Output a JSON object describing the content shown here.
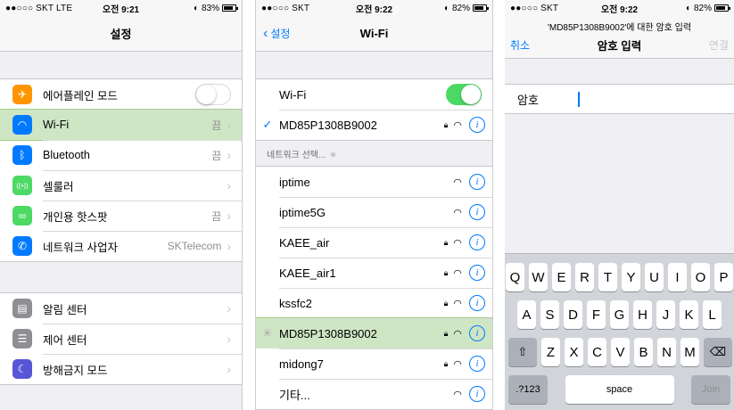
{
  "screen1": {
    "status": {
      "carrier": "●●○○○ SKT  LTE",
      "time": "오전 9:21",
      "battery": "83%"
    },
    "title": "설정",
    "group1": [
      {
        "label": "에어플레인 모드",
        "icon": "airplane-icon",
        "color": "#ff9500",
        "type": "toggle",
        "on": false
      },
      {
        "label": "Wi-Fi",
        "icon": "wifi-icon",
        "color": "#007aff",
        "value": "끔",
        "highlight": true
      },
      {
        "label": "Bluetooth",
        "icon": "bluetooth-icon",
        "color": "#007aff",
        "value": "끔"
      },
      {
        "label": "셀룰러",
        "icon": "cellular-icon",
        "color": "#4cd964",
        "value": ""
      },
      {
        "label": "개인용 핫스팟",
        "icon": "hotspot-icon",
        "color": "#4cd964",
        "value": "끔"
      },
      {
        "label": "네트워크 사업자",
        "icon": "phone-icon",
        "color": "#007aff",
        "value": "SKTelecom"
      }
    ],
    "group2": [
      {
        "label": "알림 센터",
        "icon": "notification-center-icon",
        "color": "#8e8e93"
      },
      {
        "label": "제어 센터",
        "icon": "control-center-icon",
        "color": "#8e8e93"
      },
      {
        "label": "방해금지 모드",
        "icon": "moon-icon",
        "color": "#5856d6"
      }
    ]
  },
  "screen2": {
    "status": {
      "carrier": "●●○○○ SKT",
      "time": "오전 9:22",
      "battery": "82%"
    },
    "back": "설정",
    "title": "Wi-Fi",
    "wifi_label": "Wi-Fi",
    "wifi_on": true,
    "connected": "MD85P1308B9002",
    "choose_header": "네트워크 선택...",
    "networks": [
      {
        "name": "iptime",
        "locked": false
      },
      {
        "name": "iptime5G",
        "locked": false
      },
      {
        "name": "KAEE_air",
        "locked": true
      },
      {
        "name": "KAEE_air1",
        "locked": true
      },
      {
        "name": "kssfc2",
        "locked": true
      },
      {
        "name": "MD85P1308B9002",
        "locked": true,
        "highlight": true
      },
      {
        "name": "midong7",
        "locked": true
      },
      {
        "name": "기타...",
        "locked": false
      }
    ]
  },
  "screen3": {
    "status": {
      "carrier": "●●○○○ SKT",
      "time": "오전 9:22",
      "battery": "82%"
    },
    "prompt": "'MD85P1308B9002'에 대한 암호 입력",
    "cancel": "취소",
    "title": "암호 입력",
    "join_top": "연결",
    "password_label": "암호",
    "keyboard": {
      "row1": [
        "Q",
        "W",
        "E",
        "R",
        "T",
        "Y",
        "U",
        "I",
        "O",
        "P"
      ],
      "row2": [
        "A",
        "S",
        "D",
        "F",
        "G",
        "H",
        "J",
        "K",
        "L"
      ],
      "row3": [
        "Z",
        "X",
        "C",
        "V",
        "B",
        "N",
        "M"
      ],
      "num": ".?123",
      "space": "space",
      "join": "Join"
    }
  }
}
